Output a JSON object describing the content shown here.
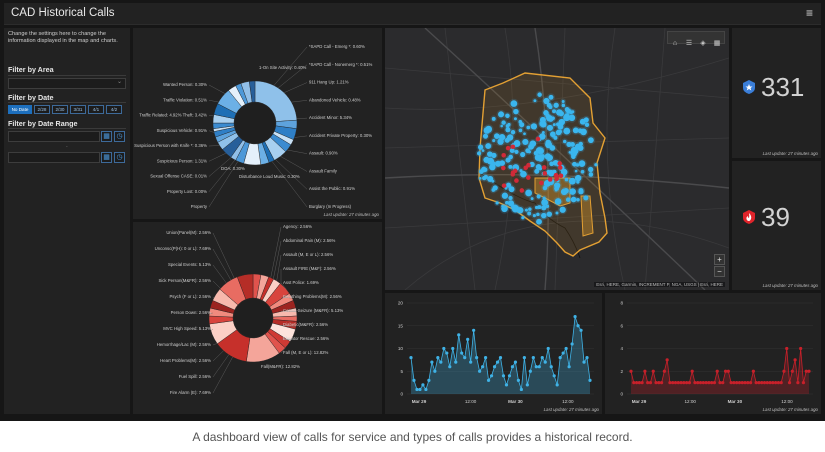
{
  "header": {
    "title": "CAD Historical Calls",
    "menu_icon": "hamburger-icon"
  },
  "sidebar": {
    "description": "Change the settings here to change the information displayed in the map and charts.",
    "filter_area_label": "Filter by Area",
    "filter_date_label": "Filter by Date",
    "date_buttons": [
      "No Date",
      "2/28",
      "2/30",
      "3/31",
      "4/1",
      "4/2"
    ],
    "filter_range_label": "Filter by Date Range",
    "range_separator": "-"
  },
  "last_update": "Last update: 27 minutes ago",
  "pie1": {
    "labels_left": [
      "Wanted Person: 0.30%",
      "Traffic Violation: 0.51%",
      "Traffic Related: 4.92% Theft: 3.42%",
      "Suspicious Vehicle: 0.91%",
      "Suspicious Person with Knife *: 0.36%",
      "Suspicious Person: 1.31%",
      "Sexual Offense CASE: 0.01%",
      "Property Lost: 0.00%",
      "Property"
    ],
    "labels_top": [
      "1-On Site Activity: 0.40%"
    ],
    "labels_right": [
      "*SAPD Call - Emerg *: 0.60%",
      "*SAPD Call - Nonemerg *: 0.51%",
      "911 Hang Up: 1.21%",
      "Abandoned Vehicle: 0.48%",
      "Accident Minor: 5.34%",
      "Accident Private Property: 0.30%",
      "Assault: 0.90%",
      "Assault Family",
      "Assist the Public: 0.91%",
      "Burglary (In Progress)"
    ],
    "labels_bottom": [
      "DOA: 0.30%",
      "Disturbance Loud Music: 0.30%"
    ]
  },
  "pie2": {
    "labels_left": [
      "Union(Panel(M): 2.56%",
      "Unconsc(P(H): 0 or L): 7.69%",
      "Special Events: 5.13%",
      "Sick Person(M&FR): 2.56%",
      "Psych (F or L): 2.56%",
      "Person Down: 2.56%",
      "MVC High Speed: 5.13%",
      "Hemorrhage/Lac (M): 2.56%",
      "Heart Problems(M): 2.56%",
      "Fuel Spill: 2.56%",
      "Fire Alarm (E): 7.69%"
    ],
    "labels_right": [
      "Agency: 2.56%",
      "Abdominal Pain (M): 2.56%",
      "Assault (M, E or L): 2.56%",
      "Assault FIRE (M&F): 2.56%",
      "Asst Police: 1.69%",
      "Breathing Problems(M): 2.56%",
      "Convul-Seizure (M&FR): 5.13%",
      "Diabetic(M&FR): 2.56%",
      "Elevator Rescue: 2.56%",
      "Fall (M, E or L): 12.82%"
    ],
    "labels_bottom": [
      "Fall(M&FR): 12.82%"
    ]
  },
  "map": {
    "attribution": "Esri, HERE, Garmin, INCREMENT P, NGA, USGS | Esri, HERE",
    "zoom_in": "+",
    "zoom_out": "−"
  },
  "kpi": [
    {
      "value": "331",
      "icon": "police-badge-icon",
      "color": "#3a7ed8"
    },
    {
      "value": "39",
      "icon": "fire-badge-icon",
      "color": "#e0242b"
    }
  ],
  "chart_data": [
    {
      "type": "line",
      "color": "#3fb2e6",
      "x_ticks": [
        "Mar 29",
        "12:00",
        "Mar 30",
        "12:00"
      ],
      "yticks": [
        0,
        5,
        10,
        15,
        20
      ],
      "ylim": [
        0,
        20
      ],
      "values": [
        8,
        3,
        1,
        1,
        2,
        1,
        3,
        7,
        5,
        8,
        7,
        10,
        9,
        6,
        10,
        7,
        13,
        9,
        8,
        12,
        7,
        14,
        8,
        5,
        6,
        8,
        3,
        4,
        6,
        7,
        8,
        4,
        2,
        4,
        6,
        7,
        3,
        1,
        8,
        2,
        5,
        8,
        6,
        6,
        8,
        7,
        10,
        6,
        4,
        2,
        8,
        9,
        10,
        6,
        11,
        17,
        15,
        14,
        7,
        8,
        3
      ]
    },
    {
      "type": "line",
      "color": "#c8202a",
      "x_ticks": [
        "Mar 29",
        "12:00",
        "Mar 30",
        "12:00"
      ],
      "yticks": [
        0,
        2,
        4,
        6,
        8
      ],
      "ylim": [
        0,
        8
      ],
      "values": [
        2,
        1,
        1,
        1,
        1,
        2,
        1,
        1,
        2,
        1,
        1,
        1,
        2,
        3,
        1,
        1,
        1,
        1,
        1,
        1,
        1,
        1,
        2,
        1,
        1,
        1,
        1,
        1,
        1,
        1,
        1,
        2,
        1,
        1,
        2,
        2,
        1,
        1,
        1,
        1,
        1,
        1,
        1,
        1,
        2,
        1,
        1,
        1,
        1,
        1,
        1,
        1,
        1,
        1,
        1,
        2,
        4,
        1,
        2,
        3,
        1,
        4,
        1,
        2,
        2
      ]
    }
  ],
  "caption": "A dashboard view of calls for service and types of calls provides a historical record."
}
